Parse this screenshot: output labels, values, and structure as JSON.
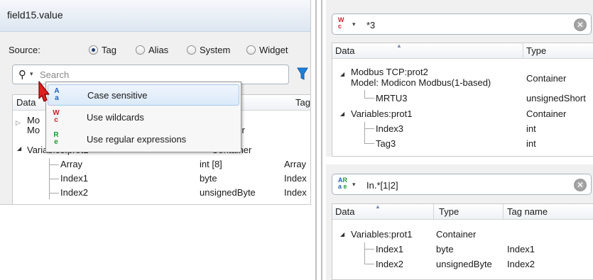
{
  "left": {
    "title": "field15.value",
    "source_label": "Source:",
    "source_options": [
      "Tag",
      "Alias",
      "System",
      "Widget"
    ],
    "selected_source": "Tag",
    "search_placeholder": "Search",
    "columns": [
      "Data",
      "Tag n"
    ],
    "rows": [
      {
        "text": "Mo",
        "col2": "",
        "col3": ""
      },
      {
        "text": "Mo",
        "col2": "ner",
        "col3": ""
      },
      {
        "text": "Variables:prot1",
        "col2": "Container",
        "col3": ""
      },
      {
        "text": "Array",
        "col2": "int [8]",
        "col3": "Array"
      },
      {
        "text": "Index1",
        "col2": "byte",
        "col3": "Index"
      },
      {
        "text": "Index2",
        "col2": "unsignedByte",
        "col3": "Index"
      }
    ],
    "menu": [
      {
        "icon": "case-sensitive-icon",
        "glyph": "A a",
        "label": "Case sensitive",
        "highlighted": true,
        "color": "#1f5fbf"
      },
      {
        "icon": "wildcards-icon",
        "glyph": "W c",
        "label": "Use wildcards",
        "highlighted": false,
        "color": "#d0202a"
      },
      {
        "icon": "regex-icon",
        "glyph": "R e",
        "label": "Use regular expressions",
        "highlighted": false,
        "color": "#1f9a2f"
      }
    ]
  },
  "panel1": {
    "search_value": "*3",
    "columns": [
      "Data",
      "Type"
    ],
    "rows": [
      {
        "text": "Modbus TCP:prot2",
        "type": ""
      },
      {
        "text": "Model: Modicon Modbus(1-based)",
        "type": "Container"
      },
      {
        "text": "MRTU3",
        "type": "unsignedShort"
      },
      {
        "text": "Variables:prot1",
        "type": "Container"
      },
      {
        "text": "Index3",
        "type": "int"
      },
      {
        "text": "Tag3",
        "type": "int"
      }
    ]
  },
  "panel2": {
    "search_value": "In.*[1|2]",
    "columns": [
      "Data",
      "Type",
      "Tag name"
    ],
    "rows": [
      {
        "text": "Variables:prot1",
        "type": "Container",
        "tag": ""
      },
      {
        "text": "Index1",
        "type": "byte",
        "tag": "Index1"
      },
      {
        "text": "Index2",
        "type": "unsignedByte",
        "tag": "Index2"
      }
    ]
  }
}
